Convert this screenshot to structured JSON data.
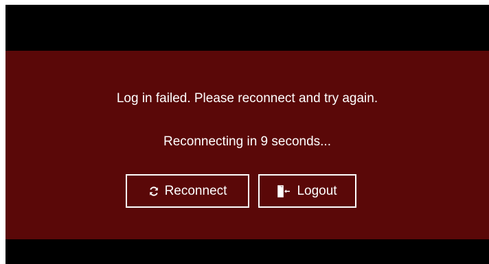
{
  "dialog": {
    "error_message": "Log in failed. Please reconnect and try again.",
    "countdown_message": "Reconnecting in 9 seconds..."
  },
  "actions": {
    "reconnect_label": "Reconnect",
    "logout_label": "Logout"
  },
  "icons": {
    "reconnect": "refresh-icon",
    "logout": "logout-door-icon"
  },
  "colors": {
    "banner": "#5a0808",
    "background": "#000000",
    "text": "#ffffff"
  }
}
